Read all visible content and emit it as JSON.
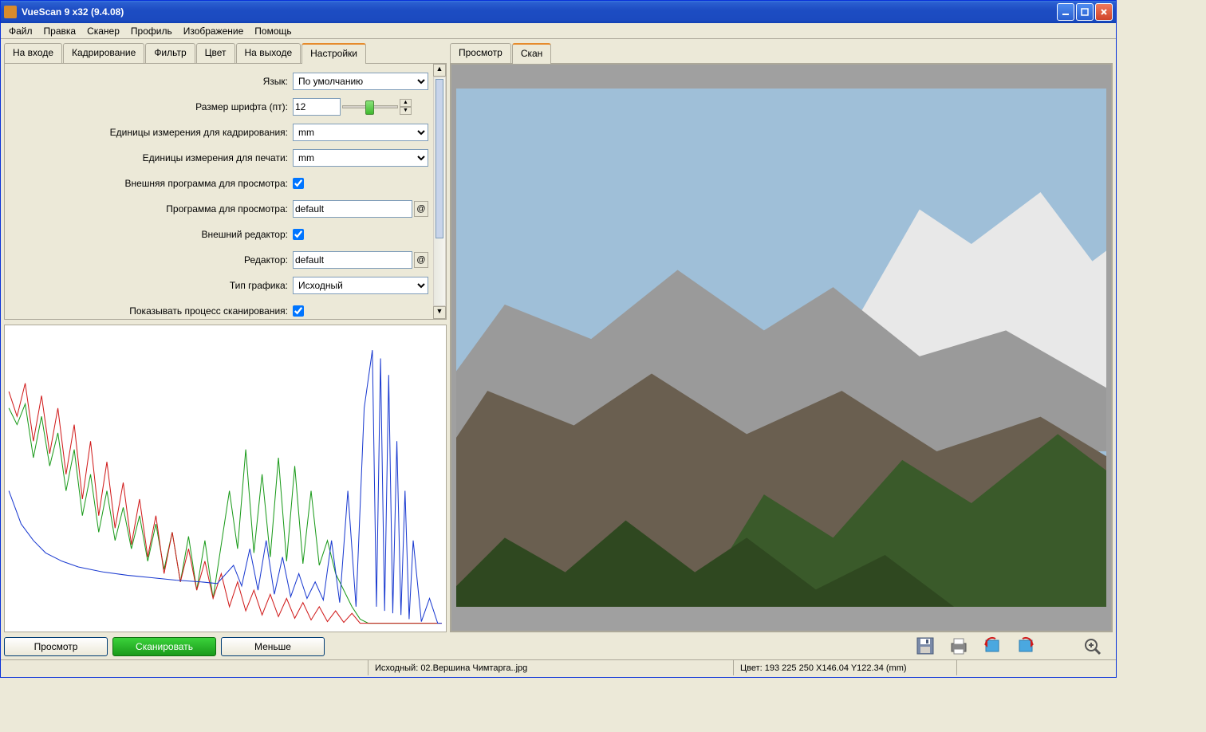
{
  "window": {
    "title": "VueScan 9 x32 (9.4.08)"
  },
  "menu": [
    "Файл",
    "Правка",
    "Сканер",
    "Профиль",
    "Изображение",
    "Помощь"
  ],
  "left_tabs": [
    "На входе",
    "Кадрирование",
    "Фильтр",
    "Цвет",
    "На выходе",
    "Настройки"
  ],
  "left_active_tab": 5,
  "right_tabs": [
    "Просмотр",
    "Скан"
  ],
  "right_active_tab": 1,
  "settings": {
    "language": {
      "label": "Язык:",
      "value": "По умолчанию"
    },
    "font_size": {
      "label": "Размер шрифта (пт):",
      "value": "12"
    },
    "crop_units": {
      "label": "Единицы измерения для кадрирования:",
      "value": "mm"
    },
    "print_units": {
      "label": "Единицы измерения для печати:",
      "value": "mm"
    },
    "ext_viewer": {
      "label": "Внешняя программа для просмотра:",
      "checked": true
    },
    "viewer_prog": {
      "label": "Программа для просмотра:",
      "value": "default"
    },
    "ext_editor": {
      "label": "Внешний редактор:",
      "checked": true
    },
    "editor_prog": {
      "label": "Редактор:",
      "value": "default"
    },
    "graph_type": {
      "label": "Тип графика:",
      "value": "Исходный"
    },
    "show_progress": {
      "label": "Показывать процесс сканирования:",
      "checked": true
    }
  },
  "actions": {
    "preview": "Просмотр",
    "scan": "Сканировать",
    "less": "Меньше"
  },
  "status": {
    "source": "Исходный: 02.Вершина Чимтарга..jpg",
    "info": "Цвет: 193 225 250   X146.04   Y122.34 (mm)"
  },
  "icons": {
    "save": "save-icon",
    "print": "print-icon",
    "rotate_left": "rotate-left-icon",
    "rotate_right": "rotate-right-icon",
    "zoom": "zoom-in-icon"
  }
}
